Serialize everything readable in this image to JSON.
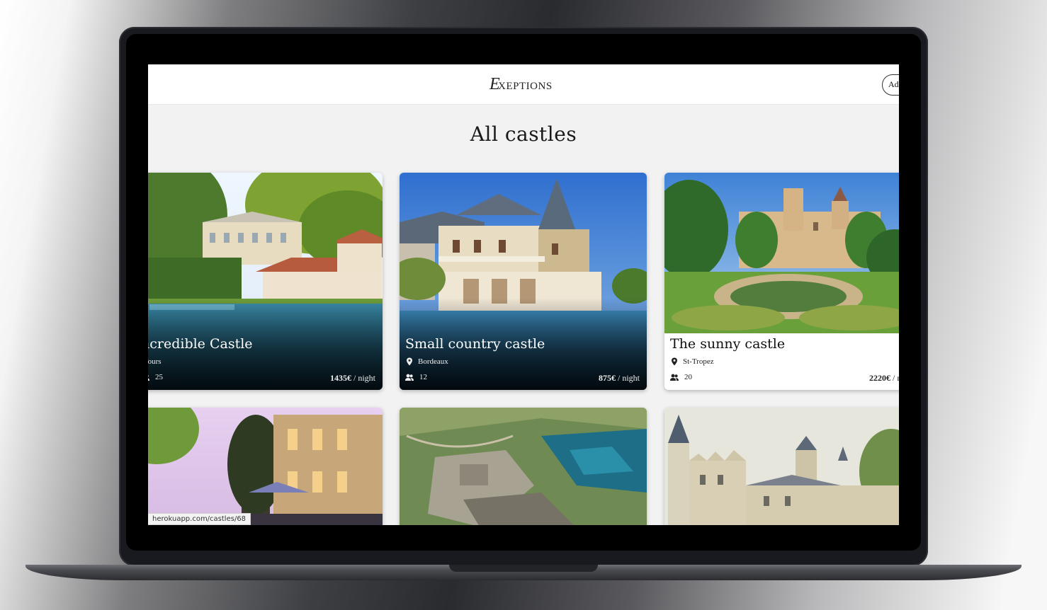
{
  "navbar": {
    "brand_initial": "E",
    "brand_rest": "XEPTIONS",
    "button_label": "Ad"
  },
  "page": {
    "title": "All castles"
  },
  "castles": [
    {
      "name": "ncredible Castle",
      "location": "-Tours",
      "guests": "25",
      "price": "1435€",
      "unit": " / night"
    },
    {
      "name": "Small country castle",
      "location": "Bordeaux",
      "guests": "12",
      "price": "875€",
      "unit": " / night"
    },
    {
      "name": "The sunny castle",
      "location": "St-Tropez",
      "guests": "20",
      "price": "2220€",
      "unit": " / night"
    }
  ],
  "status_bar": {
    "url": "herokuapp.com/castles/68"
  },
  "colors": {
    "screen_bg": "#f2f2f2",
    "laptop_frame": "#191a1f"
  }
}
